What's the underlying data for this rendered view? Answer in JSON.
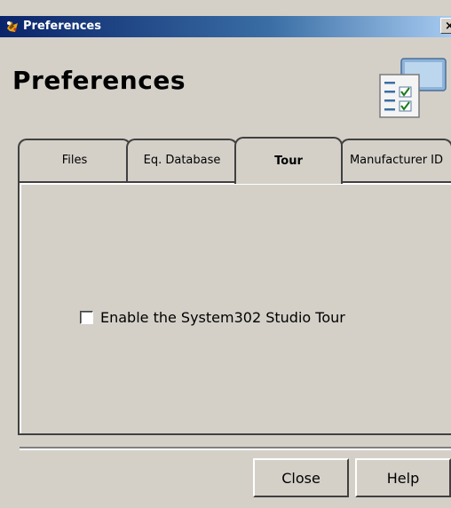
{
  "window": {
    "title": "Preferences",
    "close_glyph": "×",
    "app_icon": "s302-app-icon"
  },
  "header": {
    "title": "Preferences",
    "icon": "preferences-checklist-icon"
  },
  "tabs": [
    {
      "label": "Files",
      "active": false
    },
    {
      "label": "Eq. Database",
      "active": false
    },
    {
      "label": "Tour",
      "active": true
    },
    {
      "label": "Manufacturer ID",
      "active": false
    }
  ],
  "tour_panel": {
    "checkbox_label": "Enable the System302 Studio Tour",
    "checked": false
  },
  "buttons": {
    "close_label": "Close",
    "help_label": "Help"
  },
  "colors": {
    "face": "#d4d0c8",
    "titlebar_start": "#0a246a",
    "titlebar_end": "#a6caf0"
  }
}
